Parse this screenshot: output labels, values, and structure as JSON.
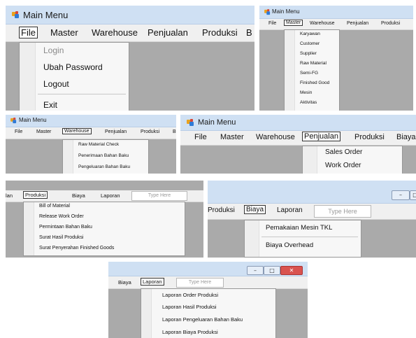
{
  "window_title": "Main Menu",
  "menubar": {
    "file": "File",
    "master": "Master",
    "warehouse": "Warehouse",
    "penjualan": "Penjualan",
    "produksi": "Produksi",
    "b_truncated": "B",
    "biaya": "Biaya",
    "laporan": "Laporan",
    "type_here": "Type Here",
    "biaya_truncated": "Biaya",
    "lan_truncated": "lan"
  },
  "file_menu": [
    "Login",
    "Ubah Password",
    "Logout",
    "Exit"
  ],
  "master_menu": [
    "Karyawan",
    "Customer",
    "Supplier",
    "Raw Material",
    "Semi-FG",
    "Finished Good",
    "Mesin",
    "Aktivitas"
  ],
  "warehouse_menu": [
    "Raw Material Check",
    "Penerimaan Bahan Baku",
    "Pengeluaran Bahan Baku"
  ],
  "penjualan_menu": [
    "Sales Order",
    "Work Order"
  ],
  "produksi_menu": [
    "Bill of Material",
    "Release Work Order",
    "Permintaan Bahan Baku",
    "Surat Hasil Produksi",
    "Surat Penyerahan Finished Goods"
  ],
  "biaya_menu": [
    "Pemakaian Mesin TKL",
    "Biaya Overhead"
  ],
  "laporan_menu": [
    "Laporan Order Produksi",
    "Laporan Hasil Produksi",
    "Laporan Pengeluaran Bahan Baku",
    "Laporan Biaya Produksi"
  ],
  "window_buttons": {
    "minimize": "–",
    "maximize": "□",
    "close": "✕"
  }
}
